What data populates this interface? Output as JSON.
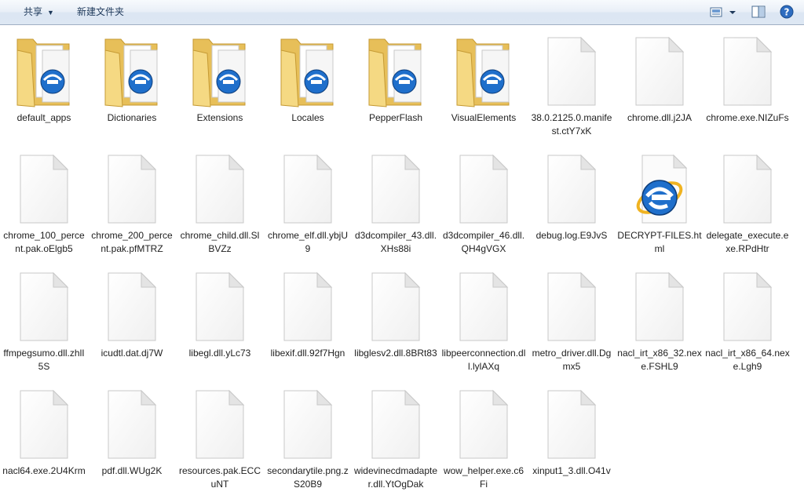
{
  "toolbar": {
    "share_label": "共享",
    "new_folder_label": "新建文件夹",
    "icons": [
      "view-options-icon",
      "preview-pane-icon",
      "help-icon"
    ]
  },
  "colors": {
    "toolbar_text": "#1e395b",
    "folder_yellow": "#f1d27c",
    "ie_blue": "#1f6fcb"
  },
  "items": [
    {
      "name": "default_apps",
      "type": "folder"
    },
    {
      "name": "Dictionaries",
      "type": "folder"
    },
    {
      "name": "Extensions",
      "type": "folder"
    },
    {
      "name": "Locales",
      "type": "folder"
    },
    {
      "name": "PepperFlash",
      "type": "folder"
    },
    {
      "name": "VisualElements",
      "type": "folder"
    },
    {
      "name": "38.0.2125.0.manifest.ctY7xK",
      "type": "file"
    },
    {
      "name": "chrome.dll.j2JA",
      "type": "file"
    },
    {
      "name": "chrome.exe.NIZuFs",
      "type": "file"
    },
    {
      "name": "chrome_100_percent.pak.oElgb5",
      "type": "file"
    },
    {
      "name": "chrome_200_percent.pak.pfMTRZ",
      "type": "file"
    },
    {
      "name": "chrome_child.dll.SlBVZz",
      "type": "file"
    },
    {
      "name": "chrome_elf.dll.ybjU9",
      "type": "file"
    },
    {
      "name": "d3dcompiler_43.dll.XHs88i",
      "type": "file"
    },
    {
      "name": "d3dcompiler_46.dll.QH4gVGX",
      "type": "file"
    },
    {
      "name": "debug.log.E9JvS",
      "type": "file"
    },
    {
      "name": "DECRYPT-FILES.html",
      "type": "html"
    },
    {
      "name": "delegate_execute.exe.RPdHtr",
      "type": "file"
    },
    {
      "name": "ffmpegsumo.dll.zhlI5S",
      "type": "file"
    },
    {
      "name": "icudtl.dat.dj7W",
      "type": "file"
    },
    {
      "name": "libegl.dll.yLc73",
      "type": "file"
    },
    {
      "name": "libexif.dll.92f7Hgn",
      "type": "file"
    },
    {
      "name": "libglesv2.dll.8BRt83",
      "type": "file"
    },
    {
      "name": "libpeerconnection.dll.lylAXq",
      "type": "file"
    },
    {
      "name": "metro_driver.dll.Dgmx5",
      "type": "file"
    },
    {
      "name": "nacl_irt_x86_32.nexe.FSHL9",
      "type": "file"
    },
    {
      "name": "nacl_irt_x86_64.nexe.Lgh9",
      "type": "file"
    },
    {
      "name": "nacl64.exe.2U4Krm",
      "type": "file"
    },
    {
      "name": "pdf.dll.WUg2K",
      "type": "file"
    },
    {
      "name": "resources.pak.ECCuNT",
      "type": "file"
    },
    {
      "name": "secondarytile.png.zS20B9",
      "type": "file"
    },
    {
      "name": "widevinecdmadapter.dll.YtOgDak",
      "type": "file"
    },
    {
      "name": "wow_helper.exe.c6Fi",
      "type": "file"
    },
    {
      "name": "xinput1_3.dll.O41v",
      "type": "file"
    }
  ]
}
